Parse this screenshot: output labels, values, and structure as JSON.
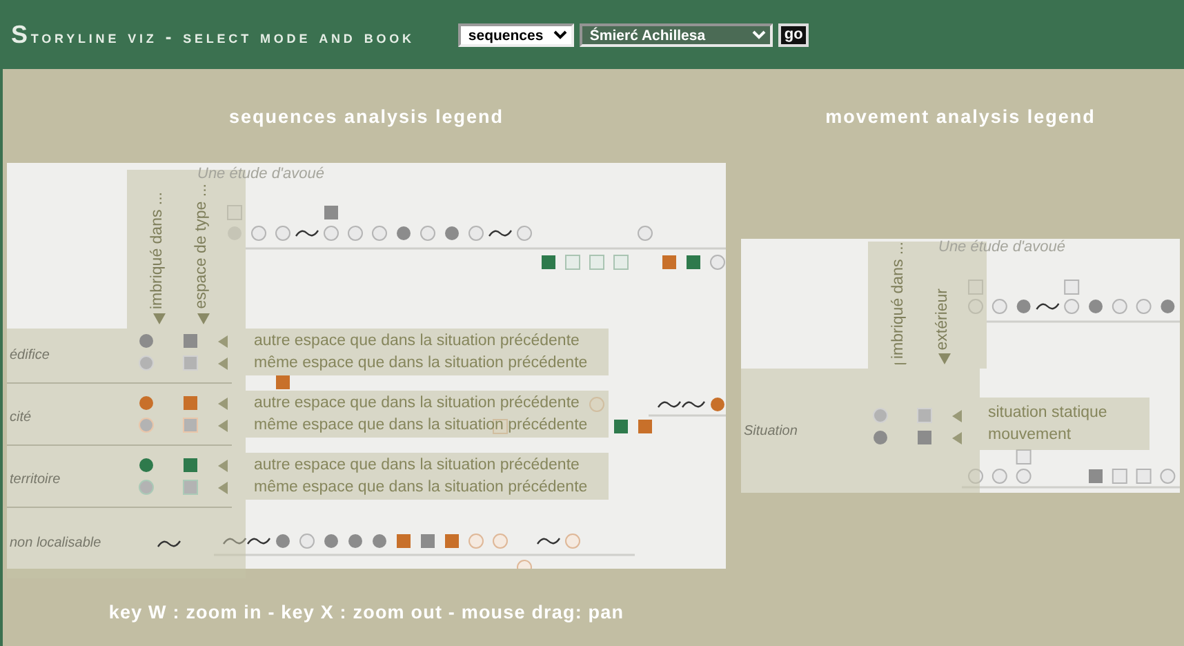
{
  "header": {
    "title": "Storyline viz - select mode and book",
    "mode": "sequences",
    "book": "Śmierć Achillesa",
    "go": "go"
  },
  "sequences": {
    "title": "sequences analysis legend",
    "caption": "Une étude d'avoué",
    "tracks": [
      {
        "marks": [
          {
            "kind": "frame",
            "color": "#b5b5b5"
          },
          {
            "kind": "gap"
          },
          {
            "kind": "gap"
          },
          {
            "kind": "gap"
          },
          {
            "kind": "block",
            "color": "#8c8c8c"
          }
        ]
      },
      {
        "marks": [
          {
            "kind": "dot",
            "color": "#c8c8c8"
          },
          {
            "kind": "ring",
            "color": "#b5b5b5"
          },
          {
            "kind": "ring",
            "color": "#b5b5b5"
          },
          {
            "kind": "wave"
          },
          {
            "kind": "ring",
            "color": "#b5b5b5"
          },
          {
            "kind": "ring",
            "color": "#b5b5b5"
          },
          {
            "kind": "ring",
            "color": "#b5b5b5"
          },
          {
            "kind": "dot",
            "color": "#8c8c8c"
          },
          {
            "kind": "ring",
            "color": "#b5b5b5"
          },
          {
            "kind": "dot",
            "color": "#8c8c8c"
          },
          {
            "kind": "ring",
            "color": "#b5b5b5"
          },
          {
            "kind": "wave"
          },
          {
            "kind": "ring",
            "color": "#b5b5b5"
          },
          {
            "kind": "gap"
          },
          {
            "kind": "gap"
          },
          {
            "kind": "gap"
          },
          {
            "kind": "gap"
          },
          {
            "kind": "ring",
            "color": "#b5b5b5"
          }
        ]
      },
      {
        "marks": [
          {
            "kind": "gap"
          },
          {
            "kind": "gap"
          },
          {
            "kind": "gap"
          },
          {
            "kind": "gap"
          },
          {
            "kind": "gap"
          },
          {
            "kind": "gap"
          },
          {
            "kind": "gap"
          },
          {
            "kind": "gap"
          },
          {
            "kind": "gap"
          },
          {
            "kind": "gap"
          },
          {
            "kind": "gap"
          },
          {
            "kind": "gap"
          },
          {
            "kind": "gap"
          },
          {
            "kind": "block",
            "color": "#2e7a4c"
          },
          {
            "kind": "frame",
            "color": "#a9c4b2"
          },
          {
            "kind": "frame",
            "color": "#a9c4b2"
          },
          {
            "kind": "frame",
            "color": "#a9c4b2"
          },
          {
            "kind": "gap"
          },
          {
            "kind": "block",
            "color": "#c8702a"
          },
          {
            "kind": "block",
            "color": "#2e7a4c"
          },
          {
            "kind": "ring",
            "color": "#b5b5b5"
          }
        ]
      },
      {
        "marks": [
          {
            "kind": "gap"
          },
          {
            "kind": "gap"
          },
          {
            "kind": "block",
            "color": "#c8702a"
          }
        ]
      },
      {
        "marks": [
          {
            "kind": "gap"
          },
          {
            "kind": "gap"
          },
          {
            "kind": "gap"
          },
          {
            "kind": "gap"
          },
          {
            "kind": "gap"
          },
          {
            "kind": "gap"
          },
          {
            "kind": "gap"
          },
          {
            "kind": "gap"
          },
          {
            "kind": "gap"
          },
          {
            "kind": "gap"
          },
          {
            "kind": "gap"
          },
          {
            "kind": "gap"
          },
          {
            "kind": "gap"
          },
          {
            "kind": "gap"
          },
          {
            "kind": "gap"
          },
          {
            "kind": "ring",
            "color": "#dfb898"
          },
          {
            "kind": "gap"
          },
          {
            "kind": "gap"
          },
          {
            "kind": "wave"
          },
          {
            "kind": "wave"
          },
          {
            "kind": "dot",
            "color": "#c8702a"
          }
        ]
      },
      {
        "marks": [
          {
            "kind": "gap"
          },
          {
            "kind": "gap"
          },
          {
            "kind": "gap"
          },
          {
            "kind": "gap"
          },
          {
            "kind": "gap"
          },
          {
            "kind": "gap"
          },
          {
            "kind": "gap"
          },
          {
            "kind": "gap"
          },
          {
            "kind": "gap"
          },
          {
            "kind": "gap"
          },
          {
            "kind": "gap"
          },
          {
            "kind": "frame",
            "color": "#dfb898"
          },
          {
            "kind": "gap"
          },
          {
            "kind": "gap"
          },
          {
            "kind": "gap"
          },
          {
            "kind": "gap"
          },
          {
            "kind": "block",
            "color": "#2e7a4c"
          },
          {
            "kind": "block",
            "color": "#c8702a"
          }
        ]
      },
      {
        "marks": [
          {
            "kind": "wave"
          },
          {
            "kind": "wave"
          },
          {
            "kind": "dot",
            "color": "#8c8c8c"
          },
          {
            "kind": "ring",
            "color": "#b5b5b5"
          },
          {
            "kind": "dot",
            "color": "#8c8c8c"
          },
          {
            "kind": "dot",
            "color": "#8c8c8c"
          },
          {
            "kind": "dot",
            "color": "#8c8c8c"
          },
          {
            "kind": "block",
            "color": "#c8702a"
          },
          {
            "kind": "block",
            "color": "#8c8c8c"
          },
          {
            "kind": "block",
            "color": "#c8702a"
          },
          {
            "kind": "ring",
            "color": "#dfb898"
          },
          {
            "kind": "ring",
            "color": "#dfb898"
          },
          {
            "kind": "gap"
          },
          {
            "kind": "wave"
          },
          {
            "kind": "ring",
            "color": "#dfb898"
          }
        ]
      },
      {
        "marks": [
          {
            "kind": "gap"
          },
          {
            "kind": "gap"
          },
          {
            "kind": "gap"
          },
          {
            "kind": "gap"
          },
          {
            "kind": "gap"
          },
          {
            "kind": "gap"
          },
          {
            "kind": "gap"
          },
          {
            "kind": "gap"
          },
          {
            "kind": "gap"
          },
          {
            "kind": "gap"
          },
          {
            "kind": "gap"
          },
          {
            "kind": "gap"
          },
          {
            "kind": "ring",
            "color": "#dfb898"
          }
        ]
      }
    ],
    "columns": [
      "imbriqué dans ...",
      "espace de type ..."
    ],
    "groups": [
      {
        "kind": "pairs",
        "label": "édifice",
        "color": "#8c8c8c",
        "rows": [
          {
            "kind": "filled",
            "text": "autre espace que dans la situation précédente"
          },
          {
            "kind": "empty",
            "text": "même espace que dans la situation précédente"
          }
        ]
      },
      {
        "kind": "pairs",
        "label": "cité",
        "color": "#c8702a",
        "rows": [
          {
            "kind": "filled",
            "text": "autre espace que dans la situation précédente"
          },
          {
            "kind": "empty",
            "text": "même espace que dans la situation précédente"
          }
        ]
      },
      {
        "kind": "pairs",
        "label": "territoire",
        "color": "#2e7a4c",
        "rows": [
          {
            "kind": "filled",
            "text": "autre espace que dans la situation précédente"
          },
          {
            "kind": "empty",
            "text": "même espace que dans la situation précédente"
          }
        ]
      },
      {
        "kind": "wave",
        "label": "non localisable"
      }
    ]
  },
  "movement": {
    "title": "movement analysis legend",
    "caption": "Une étude d'avoué",
    "tracks": [
      {
        "marks": [
          {
            "kind": "frame",
            "color": "#b5b5b5"
          },
          {
            "kind": "gap"
          },
          {
            "kind": "gap"
          },
          {
            "kind": "gap"
          },
          {
            "kind": "frame",
            "color": "#b5b5b5"
          }
        ]
      },
      {
        "marks": [
          {
            "kind": "ring",
            "color": "#b5b5b5"
          },
          {
            "kind": "ring",
            "color": "#b5b5b5"
          },
          {
            "kind": "dot",
            "color": "#8c8c8c"
          },
          {
            "kind": "wave"
          },
          {
            "kind": "ring",
            "color": "#b5b5b5"
          },
          {
            "kind": "dot",
            "color": "#8c8c8c"
          },
          {
            "kind": "ring",
            "color": "#b5b5b5"
          },
          {
            "kind": "ring",
            "color": "#b5b5b5"
          },
          {
            "kind": "dot",
            "color": "#8c8c8c"
          }
        ]
      },
      {
        "marks": [
          {
            "kind": "gap"
          },
          {
            "kind": "gap"
          },
          {
            "kind": "frame",
            "color": "#b5b5b5"
          }
        ]
      },
      {
        "marks": [
          {
            "kind": "ring",
            "color": "#b5b5b5"
          },
          {
            "kind": "ring",
            "color": "#b5b5b5"
          },
          {
            "kind": "ring",
            "color": "#b5b5b5"
          },
          {
            "kind": "gap"
          },
          {
            "kind": "gap"
          },
          {
            "kind": "block",
            "color": "#8c8c8c"
          },
          {
            "kind": "frame",
            "color": "#b5b5b5"
          },
          {
            "kind": "frame",
            "color": "#b5b5b5"
          },
          {
            "kind": "ring",
            "color": "#b5b5b5"
          }
        ]
      }
    ],
    "columns": [
      "imbriqué dans ...",
      "extérieur"
    ],
    "groups": [
      {
        "kind": "pairs",
        "label": "Situation",
        "color": "#8c8c8c",
        "rows": [
          {
            "kind": "empty",
            "text": "situation statique"
          },
          {
            "kind": "filled",
            "text": "mouvement"
          }
        ]
      }
    ]
  },
  "footer": "key W : zoom in - key X : zoom out - mouse drag: pan"
}
